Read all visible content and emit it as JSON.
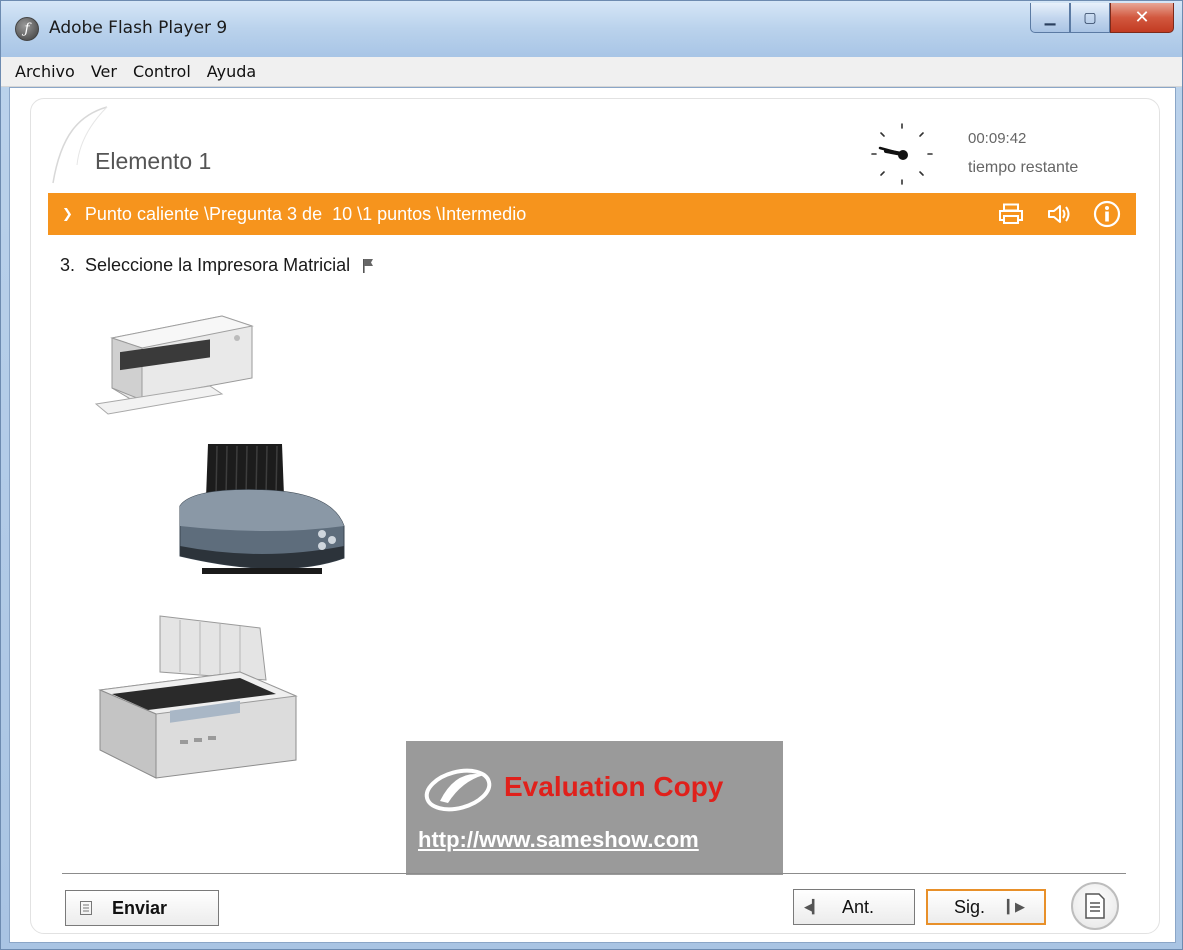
{
  "window": {
    "title": "Adobe Flash Player 9",
    "app_icon_glyph": "ƒ",
    "controls": {
      "minimize": "▁",
      "maximize": "▢",
      "close": "✕"
    }
  },
  "menu": {
    "items": [
      "Archivo",
      "Ver",
      "Control",
      "Ayuda"
    ]
  },
  "header": {
    "title": "Elemento 1",
    "timer": {
      "value": "00:09:42",
      "label": "tiempo restante"
    }
  },
  "info_bar": {
    "chevron": "❯",
    "text": "Punto caliente \\Pregunta 3 de  10 \\1 puntos \\Intermedio",
    "icons": [
      "printer-icon",
      "speaker-icon",
      "info-icon"
    ],
    "color": "#f6941d"
  },
  "question": {
    "number": "3.",
    "text": "Seleccione la Impresora Matricial"
  },
  "watermark": {
    "title": "Evaluation Copy",
    "url": "http://www.sameshow.com"
  },
  "footer": {
    "submit_label": "Enviar",
    "prev_label": "Ant.",
    "next_label": "Sig.",
    "prev_arrow": "◀▎",
    "next_arrow": "▎▶"
  }
}
